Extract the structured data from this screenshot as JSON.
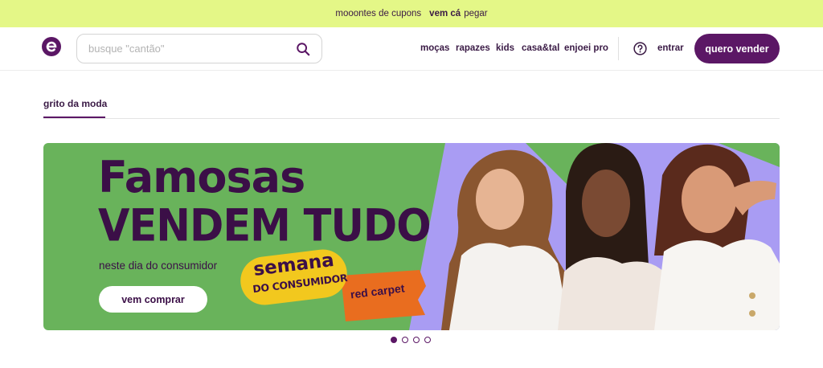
{
  "promo": {
    "text": "mooontes de cupons",
    "separator": "",
    "link": "vem cá",
    "suffix": "pegar"
  },
  "header": {
    "logo_letter": "e",
    "search": {
      "placeholder": "busque \"cantão\"",
      "value": ""
    },
    "nav": [
      "moças",
      "rapazes",
      "kids",
      "casa&tal",
      "enjoei pro"
    ],
    "login": "entrar",
    "sell_button": "quero vender"
  },
  "tabs": {
    "active": "grito da moda"
  },
  "banner": {
    "headline_line1": "Famosas",
    "headline_line2": "VENDEM TUDO",
    "subtitle": "neste dia do consumidor",
    "cta": "vem comprar",
    "stamp_line1": "semana",
    "stamp_line2": "DO CONSUMIDOR",
    "flag": "red carpet"
  },
  "carousel": {
    "slides": 4,
    "active_index": 0
  },
  "colors": {
    "brand": "#5b1765",
    "promo_bg": "#e4f787",
    "banner_green": "#69b35b",
    "lilac": "#a99cf3",
    "stamp_yellow": "#f2c81e",
    "flag_orange": "#e96d1f"
  }
}
